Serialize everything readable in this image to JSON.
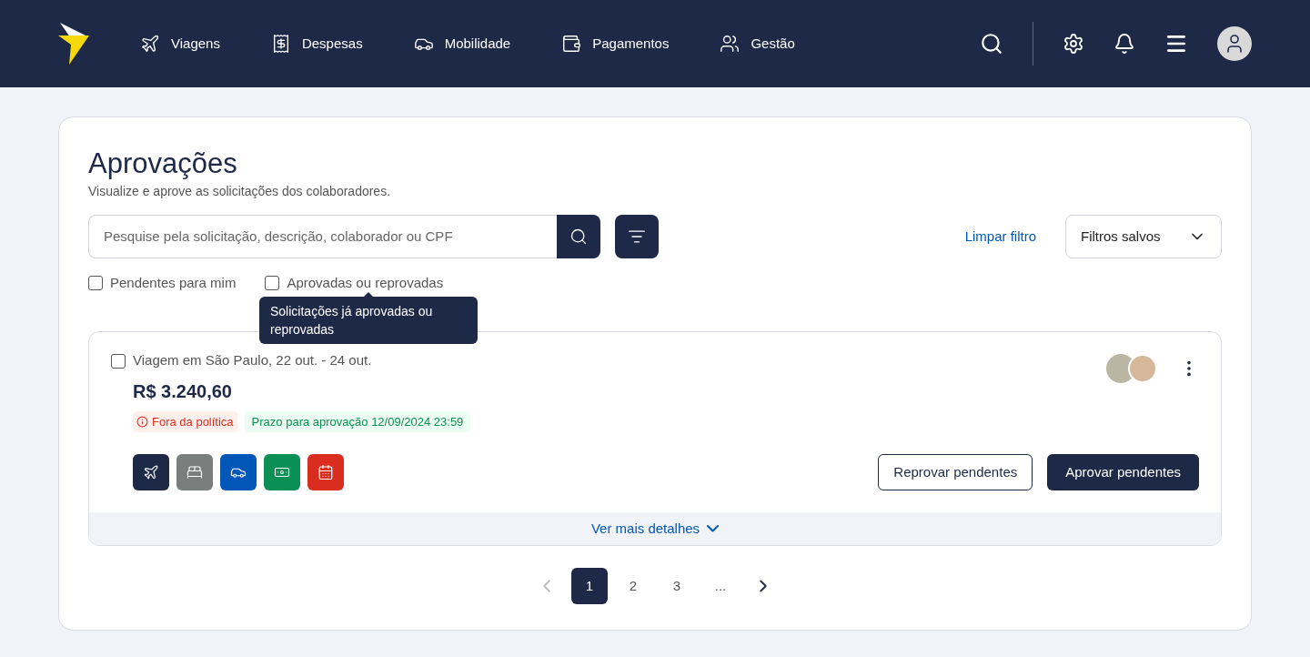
{
  "nav": {
    "items": [
      {
        "kind": "travel",
        "label": "Viagens"
      },
      {
        "kind": "expenses",
        "label": "Despesas"
      },
      {
        "kind": "mobility",
        "label": "Mobilidade"
      },
      {
        "kind": "payments",
        "label": "Pagamentos"
      },
      {
        "kind": "management",
        "label": "Gestão"
      }
    ]
  },
  "page": {
    "title": "Aprovações",
    "subtitle": "Visualize e aprove as solicitações dos colaboradores."
  },
  "search": {
    "placeholder": "Pesquise pela solicitação, descrição, colaborador ou CPF"
  },
  "clear_filter": "Limpar filtro",
  "saved_filters": {
    "value": "Filtros salvos"
  },
  "filters": [
    {
      "label": "Pendentes para mim",
      "checked": false
    },
    {
      "label": "Aprovadas ou reprovadas",
      "checked": false
    }
  ],
  "tooltip": "Solicitações já aprovadas ou reprovadas",
  "request": {
    "checked": false,
    "title": "Viagem em São Paulo, 22 out. - 24 out.",
    "amount": "R$ 3.240,60",
    "policy_badge": "Fora da política",
    "deadline_badge": "Prazo para aprovação 12/09/2024 23:59",
    "services": [
      {
        "kind": "flight",
        "color": "#1e2847"
      },
      {
        "kind": "hotel",
        "color": "#7a7f7e"
      },
      {
        "kind": "car",
        "color": "#0057b8"
      },
      {
        "kind": "cash",
        "color": "#0a8f55"
      },
      {
        "kind": "event",
        "color": "#d92d20"
      }
    ],
    "reject_button": "Reprovar pendentes",
    "approve_button": "Aprovar pendentes",
    "details_link": "Ver mais detalhes"
  },
  "pagination": {
    "prev_disabled": true,
    "pages": [
      {
        "label": "1",
        "selected": true
      },
      {
        "label": "2",
        "selected": false
      },
      {
        "label": "3",
        "selected": false
      },
      {
        "label": "...",
        "selected": false
      }
    ]
  }
}
